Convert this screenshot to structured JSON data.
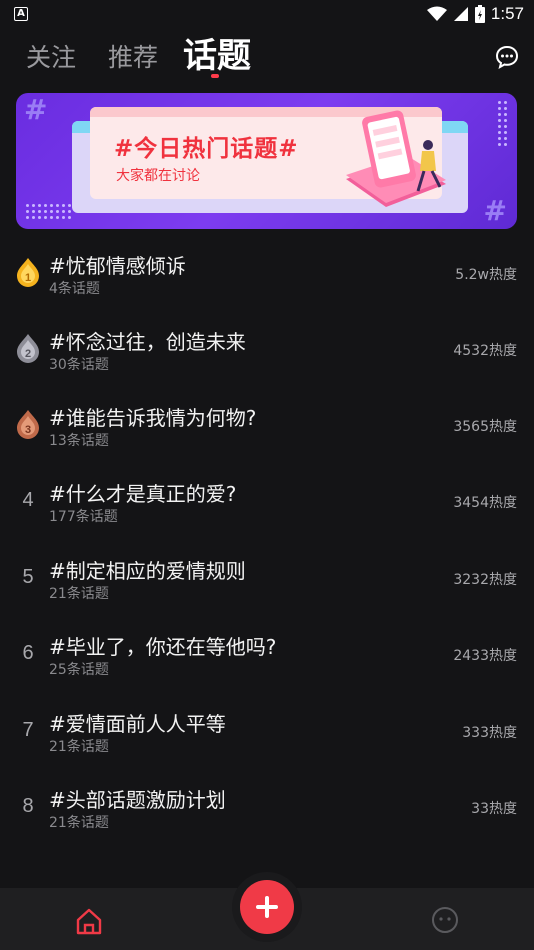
{
  "status_bar": {
    "app_icon": "A",
    "time": "1:57",
    "icons": [
      "wifi-icon",
      "signal-icon",
      "battery-charging-icon"
    ]
  },
  "tabs": [
    {
      "label": "关注",
      "active": false
    },
    {
      "label": "推荐",
      "active": false
    },
    {
      "label": "话题",
      "active": true
    }
  ],
  "header_icons": [
    "message-icon"
  ],
  "banner": {
    "title": "#今日热门话题#",
    "subtitle": "大家都在讨论",
    "colors": {
      "background": "#6a2de0",
      "accent": "#f0323e"
    }
  },
  "topics": [
    {
      "rank": "1",
      "badge": "gold-medal-icon",
      "title": "#忧郁情感倾诉",
      "count": "4条话题",
      "heat": "5.2w热度"
    },
    {
      "rank": "2",
      "badge": "silver-medal-icon",
      "title": "#怀念过往，创造未来",
      "count": "30条话题",
      "heat": "4532热度"
    },
    {
      "rank": "3",
      "badge": "bronze-medal-icon",
      "title": "#谁能告诉我情为何物?",
      "count": "13条话题",
      "heat": "3565热度"
    },
    {
      "rank": "4",
      "badge": "",
      "title": "#什么才是真正的爱?",
      "count": "177条话题",
      "heat": "3454热度"
    },
    {
      "rank": "5",
      "badge": "",
      "title": "#制定相应的爱情规则",
      "count": "21条话题",
      "heat": "3232热度"
    },
    {
      "rank": "6",
      "badge": "",
      "title": "#毕业了，你还在等他吗?",
      "count": "25条话题",
      "heat": "2433热度"
    },
    {
      "rank": "7",
      "badge": "",
      "title": "#爱情面前人人平等",
      "count": "21条话题",
      "heat": "333热度"
    },
    {
      "rank": "8",
      "badge": "",
      "title": "#头部话题激励计划",
      "count": "21条话题",
      "heat": "33热度"
    }
  ],
  "bottom_nav": {
    "items": [
      "home-icon",
      "add-icon",
      "profile-face-icon"
    ],
    "active": "home-icon",
    "colors": {
      "active": "#f03a47",
      "inactive": "#5a5a5e"
    }
  }
}
